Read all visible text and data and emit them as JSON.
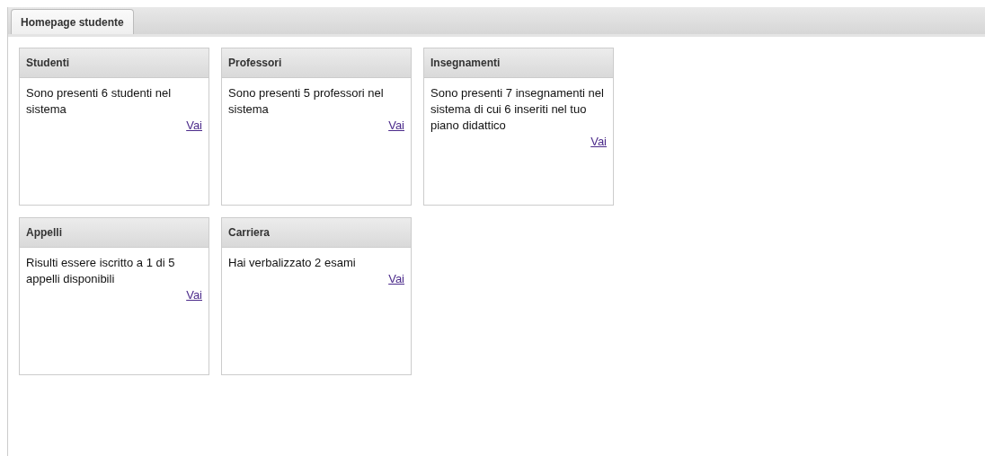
{
  "tabs": [
    {
      "label": "Homepage studente",
      "selected": true
    }
  ],
  "panels": [
    {
      "title": "Studenti",
      "text": "Sono presenti 6 studenti nel sistema",
      "link": "Vai"
    },
    {
      "title": "Professori",
      "text": "Sono presenti 5 professori nel sistema",
      "link": "Vai"
    },
    {
      "title": "Insegnamenti",
      "text": "Sono presenti 7 insegnamenti nel sistema di cui 6 inseriti nel tuo piano didattico",
      "link": "Vai"
    },
    {
      "title": "Appelli",
      "text": "Risulti essere iscritto a 1 di 5 appelli disponibili",
      "link": "Vai"
    },
    {
      "title": "Carriera",
      "text": "Hai verbalizzato 2 esami",
      "link": "Vai"
    }
  ]
}
